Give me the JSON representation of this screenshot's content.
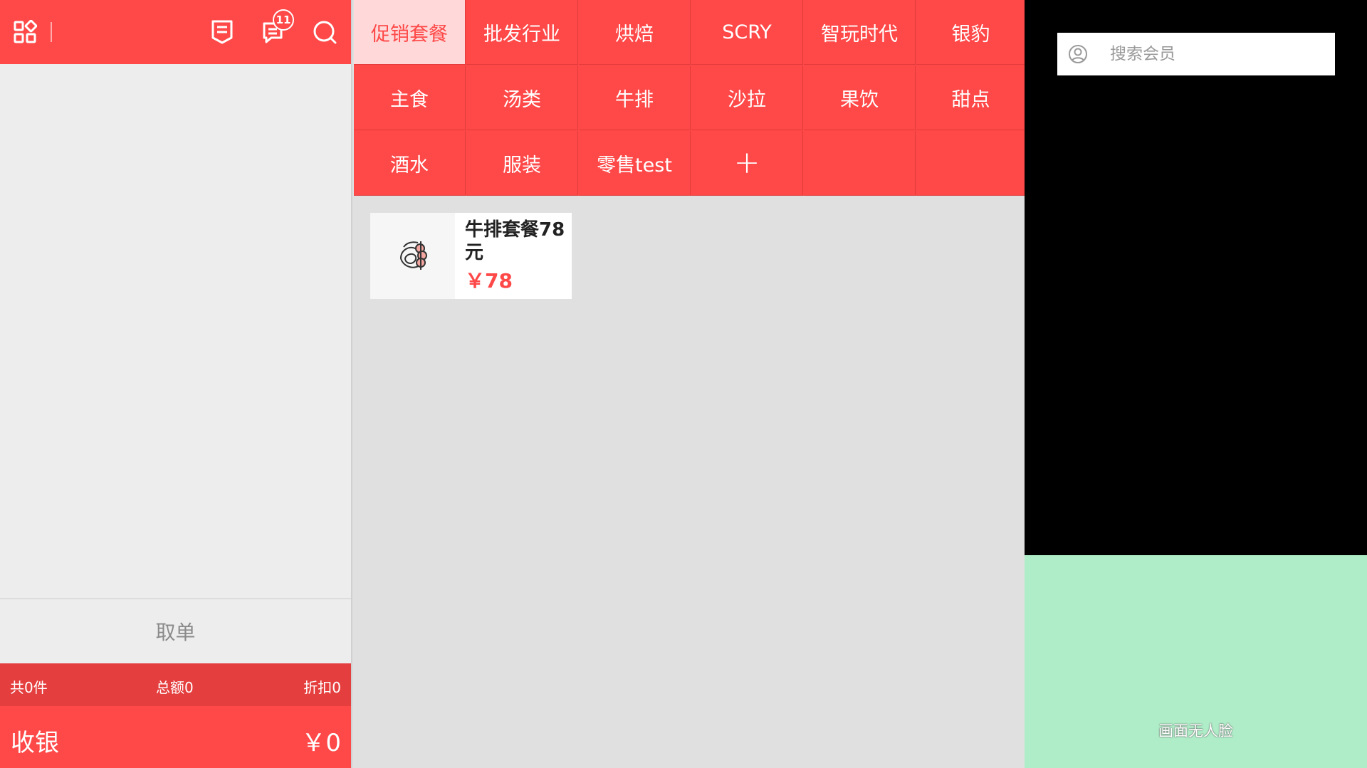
{
  "left": {
    "notification_count": "11",
    "take_order_label": "取单",
    "summary": {
      "count_text": "共0件",
      "total_text": "总额0",
      "discount_text": "折扣0"
    },
    "checkout": {
      "label": "收银",
      "amount": "￥0"
    }
  },
  "categories": [
    {
      "label": "促销套餐",
      "active": true
    },
    {
      "label": "批发行业"
    },
    {
      "label": "烘焙"
    },
    {
      "label": "SCRY"
    },
    {
      "label": "智玩时代"
    },
    {
      "label": "银豹"
    },
    {
      "label": "主食"
    },
    {
      "label": "汤类"
    },
    {
      "label": "牛排"
    },
    {
      "label": "沙拉"
    },
    {
      "label": "果饮"
    },
    {
      "label": "甜点"
    },
    {
      "label": "酒水"
    },
    {
      "label": "服装"
    },
    {
      "label": "零售test"
    },
    {
      "label": "+"
    }
  ],
  "products": [
    {
      "name": "牛排套餐78元",
      "price": "￥78",
      "icon": "steak-meal-icon"
    }
  ],
  "right": {
    "member_search_placeholder": "搜索会员",
    "face_status": "画面无人脸"
  },
  "colors": {
    "primary_red": "#ff4848",
    "active_tab_bg": "#ffd9d9",
    "face_panel": "#aeedc7"
  }
}
